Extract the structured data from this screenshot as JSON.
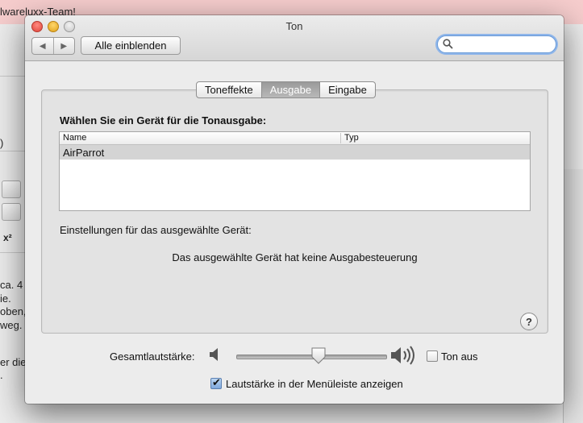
{
  "background_app": {
    "banner_text": "lwareluxx-Team!",
    "content_lines": [
      {
        "text": "ca. 4",
        "color": "#222"
      },
      {
        "text": "ie.",
        "color": "#222"
      },
      {
        "text": "oben,",
        "color": "#222"
      },
      {
        "text": "weg.",
        "color": "#222"
      },
      {
        "text": "er die",
        "color": "#222"
      },
      {
        "text": ".",
        "color": "#222"
      }
    ],
    "paren_text": ")",
    "superscript_icon_text": "x²"
  },
  "window": {
    "title": "Ton",
    "show_all_label": "Alle einblenden",
    "search_placeholder": ""
  },
  "tabs": [
    {
      "label": "Toneffekte",
      "active": false
    },
    {
      "label": "Ausgabe",
      "active": true
    },
    {
      "label": "Eingabe",
      "active": false
    }
  ],
  "output": {
    "section_title": "Wählen Sie ein Gerät für die Tonausgabe:",
    "columns": {
      "name": "Name",
      "type": "Typ"
    },
    "devices": [
      {
        "name": "AirParrot",
        "type": ""
      }
    ],
    "settings_label": "Einstellungen für das ausgewählte Gerät:",
    "no_control_message": "Das ausgewählte Gerät hat keine Ausgabesteuerung",
    "help_label": "?"
  },
  "volume": {
    "label": "Gesamtlautstärke:",
    "level": 0.55,
    "mute_label": "Ton aus",
    "mute_checked": false,
    "menubar_label": "Lautstärke in der Menüleiste anzeigen",
    "menubar_checked": true
  },
  "icons": {
    "back": "chevron-left-icon",
    "forward": "chevron-right-icon",
    "search": "search-icon",
    "volume_low": "speaker-low-icon",
    "volume_high": "speaker-high-icon"
  }
}
